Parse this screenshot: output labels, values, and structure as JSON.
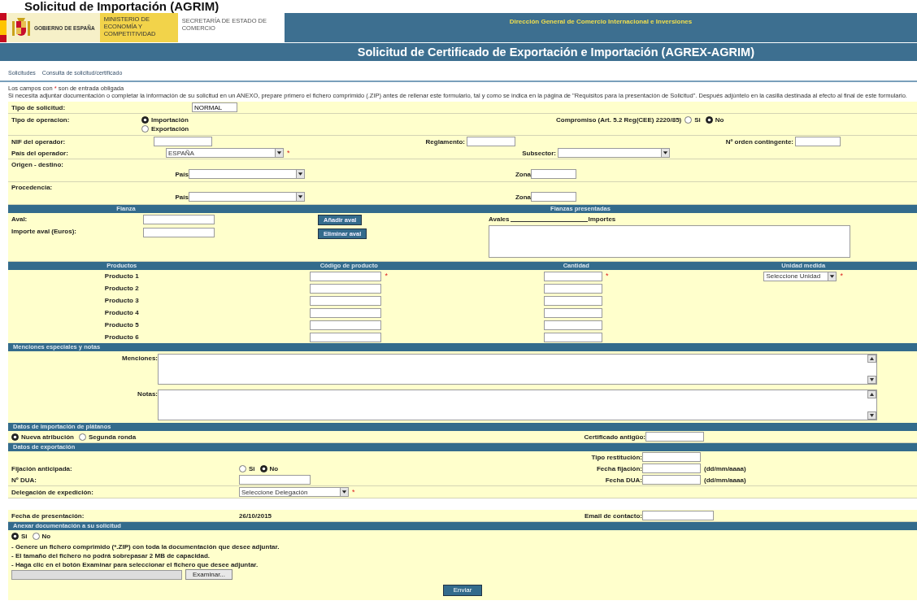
{
  "page_heading": "Solicitud de Importación (AGRIM)",
  "banner": {
    "government": "GOBIERNO DE ESPAÑA",
    "ministry": "MINISTERIO DE ECONOMÍA Y COMPETITIVIDAD",
    "secretariat": "SECRETARÍA DE ESTADO DE COMERCIO",
    "directorate": "Dirección General de Comercio Internacional e Inversiones",
    "title": "Solicitud de Certificado de Exportación e Importación (AGREX-AGRIM)"
  },
  "nav_links": [
    "Solicitudes",
    "Consulta de solicitud/certificado"
  ],
  "required_note": {
    "before": "Los campos con",
    "mark": "*",
    "after": "son de entrada obligada"
  },
  "annex_note": "Si necesita adjuntar documentación o completar la información de su solicitud en un ANEXO, prepare primero el fichero comprimido (.ZIP) antes de rellenar este formulario, tal y como se indica en la página de \"Requisitos para la presentación de Solicitud\". Después adjúntelo en la casilla destinada al efecto al final de este formulario.",
  "general": {
    "tipo_solicitud": {
      "label": "Tipo de solicitud:",
      "value": "NORMAL"
    },
    "tipo_operacion": {
      "label": "Tipo de operacion:",
      "options": [
        {
          "label": "Importación",
          "selected": true
        },
        {
          "label": "Exportación",
          "selected": false
        }
      ]
    },
    "compromiso": {
      "label": "Compromiso (Art. 5.2 Reg(CEE) 2220/85)",
      "options": [
        {
          "label": "Si",
          "selected": false
        },
        {
          "label": "No",
          "selected": true
        }
      ]
    },
    "nif": {
      "label": "NIF del operador:"
    },
    "reglamento": {
      "label": "Reglamento:"
    },
    "orden_contingente": {
      "label": "Nº orden contingente:"
    },
    "pais_operador": {
      "label": "País del operador:",
      "value": "ESPAÑA",
      "required_mark": "*"
    },
    "subsector": {
      "label": "Subsector:"
    },
    "origen": {
      "label": "Origen - destino:",
      "pais_label": "País",
      "zona_label": "Zona"
    },
    "procedencia": {
      "label": "Procedencia:",
      "pais_label": "País",
      "zona_label": "Zona"
    }
  },
  "fianza": {
    "header": "Fianza",
    "aval_label": "Aval:",
    "importe_label": "Importe aval (Euros):",
    "buttons": [
      "Añadir aval",
      "Eliminar aval"
    ],
    "presented_header": "Fianzas presentadas",
    "avales_label": "Avales",
    "importes_label": "Importes"
  },
  "products": {
    "columns": [
      "Productos",
      "Código de producto",
      "Cantidad",
      "Unidad medida"
    ],
    "rows": [
      {
        "name": "Producto 1",
        "code_required_mark": "*",
        "quantity_required_mark": "*",
        "unit": "Seleccione Unidad",
        "unit_required_mark": "*"
      },
      {
        "name": "Producto 2"
      },
      {
        "name": "Producto 3"
      },
      {
        "name": "Producto 4"
      },
      {
        "name": "Producto 5"
      },
      {
        "name": "Producto 6"
      }
    ]
  },
  "menciones": {
    "header": "Menciones especiales y notas",
    "fields": [
      {
        "label": "Menciones:"
      },
      {
        "label": "Notas:"
      }
    ]
  },
  "platanos": {
    "header": "Datos de importación de plátanos",
    "options": [
      {
        "label": "Nueva atribución",
        "selected": true
      },
      {
        "label": "Segunda ronda",
        "selected": false
      }
    ],
    "certificado_label": "Certificado antigüo:"
  },
  "exportacion": {
    "header": "Datos de exportación",
    "tipo_restitucion_label": "Tipo restitución:",
    "fijacion": {
      "label": "Fijación anticipada:",
      "options": [
        {
          "label": "Si",
          "selected": false
        },
        {
          "label": "No",
          "selected": true
        }
      ]
    },
    "fecha_fijacion_label": "Fecha fijación:",
    "fecha_fijacion_hint": "(dd/mm/aaaa)",
    "dua_label": "Nº DUA:",
    "fecha_dua_label": "Fecha DUA:",
    "fecha_dua_hint": "(dd/mm/aaaa)",
    "delegacion": {
      "label": "Delegación de expedición:",
      "value": "Seleccione Delegación",
      "required_mark": "*"
    }
  },
  "presentacion": {
    "fecha_label": "Fecha de presentación:",
    "fecha": "26/10/2015",
    "email_label": "Email de contacto:"
  },
  "anexo": {
    "header": "Anexar documentación a su solicitud",
    "options": [
      {
        "label": "Si",
        "selected": true
      },
      {
        "label": "No",
        "selected": false
      }
    ],
    "instructions": [
      "- Genere un fichero comprimido (*.ZIP) con toda la documentación que desee adjuntar.",
      "- El tamaño del fichero no podrá sobrepasar 2 MB de capacidad.",
      "- Haga clic en el botón Examinar para seleccionar el fichero que desee adjuntar."
    ],
    "browse_button": "Examinar..."
  },
  "submit": "Enviar"
}
